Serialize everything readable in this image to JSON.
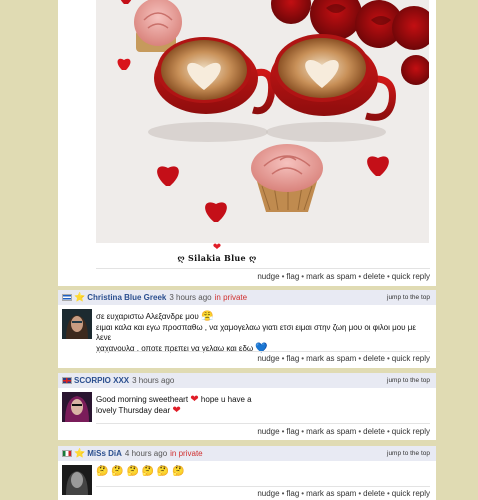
{
  "top_post": {
    "heart": "❤",
    "signature": "ღ Silakia Blue ღ",
    "actions": [
      "nudge",
      "flag",
      "mark as spam",
      "delete",
      "quick reply"
    ]
  },
  "comments": [
    {
      "flag": "greece",
      "badge": "⭐",
      "username": "Christina Blue Greek",
      "time": "3 hours ago",
      "private": "in private",
      "jump": "jump to the top",
      "line1": "σε ευχαριστω Αλεξανδρε μου",
      "line1_emoji": "😤",
      "line2": "ειμαι καλα και εγω προσπαθω , να χαμογελαω γιατι ετσι ειμαι στην ζωη μου οι φιλοι μου με λενε",
      "line3": "χαχανουλα , οποτε πρεπει να γελαω και εδω",
      "line3_emoji": "💙",
      "actions": [
        "nudge",
        "flag",
        "mark as spam",
        "delete",
        "quick reply"
      ]
    },
    {
      "flag": "uk",
      "username": "SCORPIO XXX",
      "time": "3 hours ago",
      "jump": "jump to the top",
      "line1": "Good morning sweetheart",
      "line1_emoji": "❤",
      "line1_rest": "hope u have a",
      "line2": "lovely Thursday dear",
      "line2_emoji": "❤",
      "actions": [
        "nudge",
        "flag",
        "mark as spam",
        "delete",
        "quick reply"
      ]
    },
    {
      "flag": "mexico",
      "badge": "⭐",
      "username": "MiSs DiA",
      "time": "4 hours ago",
      "private": "in private",
      "jump": "jump to the top",
      "emojis": "🤔 🤔 🤔 🤔 🤔 🤔",
      "actions": [
        "nudge",
        "flag",
        "mark as spam",
        "delete",
        "quick reply"
      ]
    }
  ]
}
